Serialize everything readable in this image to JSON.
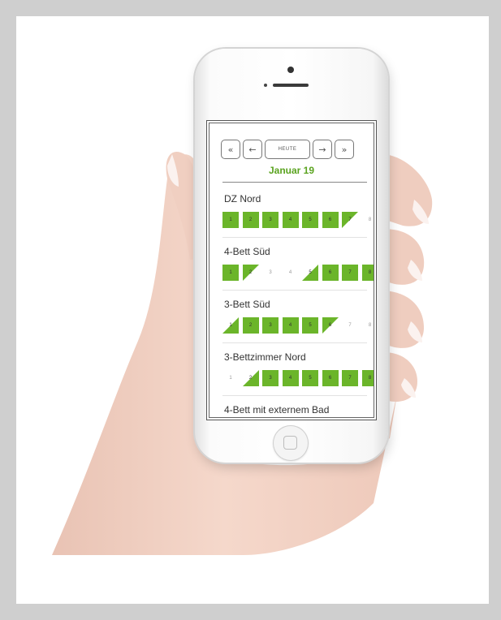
{
  "nav": {
    "first_icon": "double-arrow-left-icon",
    "prev_icon": "arrow-left-icon",
    "today_label": "HEUTE",
    "next_icon": "arrow-right-icon",
    "last_icon": "double-arrow-right-icon"
  },
  "month_label": "Januar 19",
  "colors": {
    "booked": "#6bb52a",
    "accent_text": "#5aa31f",
    "free_text": "#999999"
  },
  "rooms": [
    {
      "name": "DZ Nord",
      "days": [
        {
          "label": "1",
          "state": "booked"
        },
        {
          "label": "2",
          "state": "booked"
        },
        {
          "label": "3",
          "state": "booked"
        },
        {
          "label": "4",
          "state": "booked"
        },
        {
          "label": "5",
          "state": "booked"
        },
        {
          "label": "6",
          "state": "booked"
        },
        {
          "label": "7",
          "state": "checkout"
        },
        {
          "label": "8",
          "state": "free"
        }
      ]
    },
    {
      "name": "4-Bett Süd",
      "days": [
        {
          "label": "1",
          "state": "booked"
        },
        {
          "label": "2",
          "state": "checkout"
        },
        {
          "label": "3",
          "state": "free"
        },
        {
          "label": "4",
          "state": "free"
        },
        {
          "label": "5",
          "state": "checkin"
        },
        {
          "label": "6",
          "state": "booked"
        },
        {
          "label": "7",
          "state": "booked"
        },
        {
          "label": "8",
          "state": "booked"
        }
      ]
    },
    {
      "name": "3-Bett Süd",
      "days": [
        {
          "label": "1",
          "state": "checkin"
        },
        {
          "label": "2",
          "state": "booked"
        },
        {
          "label": "3",
          "state": "booked"
        },
        {
          "label": "4",
          "state": "booked"
        },
        {
          "label": "5",
          "state": "booked"
        },
        {
          "label": "6",
          "state": "checkout"
        },
        {
          "label": "7",
          "state": "free"
        },
        {
          "label": "8",
          "state": "free"
        }
      ]
    },
    {
      "name": "3-Bettzimmer Nord",
      "days": [
        {
          "label": "1",
          "state": "free"
        },
        {
          "label": "2",
          "state": "checkin"
        },
        {
          "label": "3",
          "state": "booked"
        },
        {
          "label": "4",
          "state": "booked"
        },
        {
          "label": "5",
          "state": "booked"
        },
        {
          "label": "6",
          "state": "booked"
        },
        {
          "label": "7",
          "state": "booked"
        },
        {
          "label": "8",
          "state": "booked"
        }
      ]
    },
    {
      "name": "4-Bett mit externem Bad",
      "days": []
    }
  ]
}
